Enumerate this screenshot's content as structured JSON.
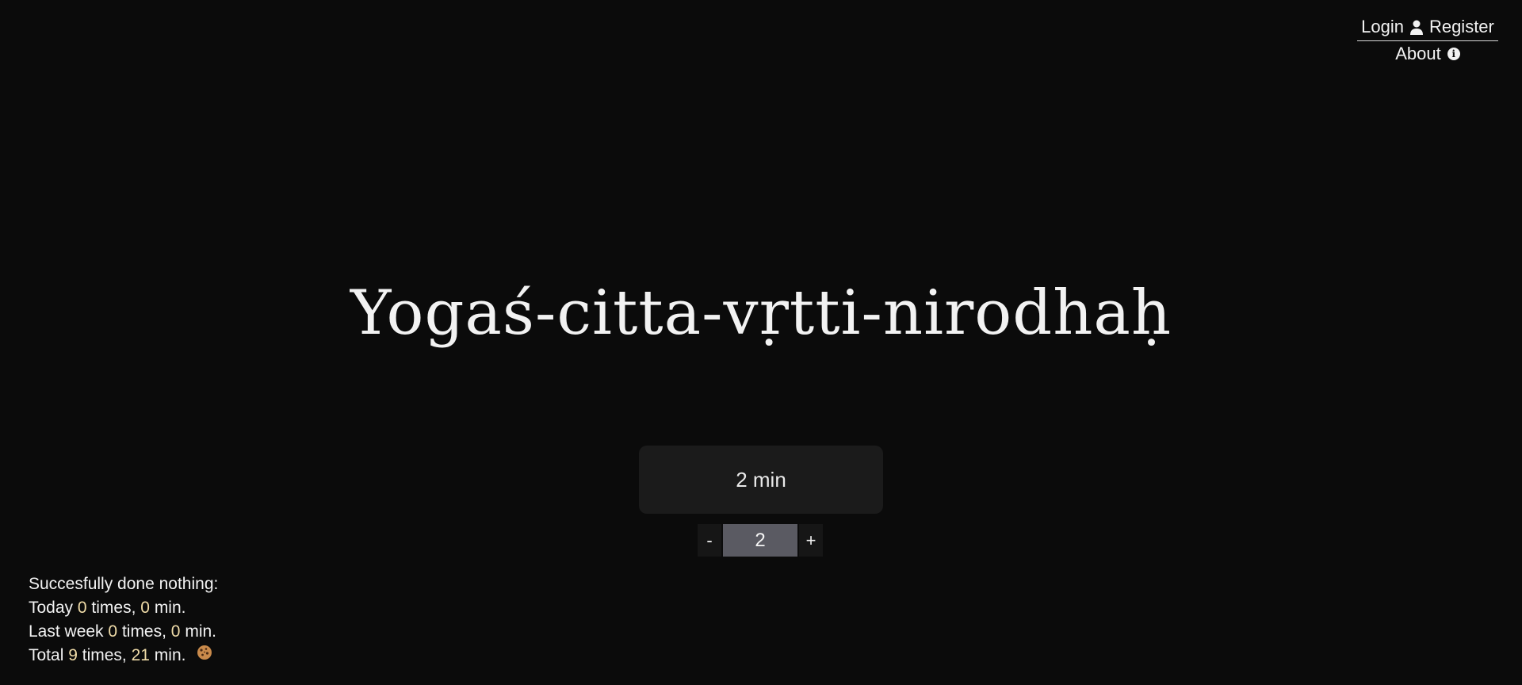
{
  "nav": {
    "login_label": "Login",
    "register_label": "Register",
    "about_label": "About",
    "user_icon": "user-icon",
    "info_icon": "info-icon"
  },
  "title": "Yogaś-citta-vṛtti-nirodhaḥ",
  "timer": {
    "display": "2 min",
    "decrement_label": "-",
    "value": "2",
    "increment_label": "+"
  },
  "stats": {
    "heading": "Succesfully done nothing:",
    "today": {
      "label": "Today",
      "times": "0",
      "times_suffix": "times,",
      "minutes": "0",
      "minutes_suffix": "min."
    },
    "last_week": {
      "label": "Last week",
      "times": "0",
      "times_suffix": "times,",
      "minutes": "0",
      "minutes_suffix": "min."
    },
    "total": {
      "label": "Total",
      "times": "9",
      "times_suffix": "times,",
      "minutes": "21",
      "minutes_suffix": "min."
    },
    "cookie_icon": "cookie-icon"
  },
  "colors": {
    "background": "#0b0b0b",
    "text": "#f2f2f2",
    "accent_number": "#f0dca8",
    "timer_box": "#1b1b1b",
    "stepper_value": "#5a5a62"
  }
}
